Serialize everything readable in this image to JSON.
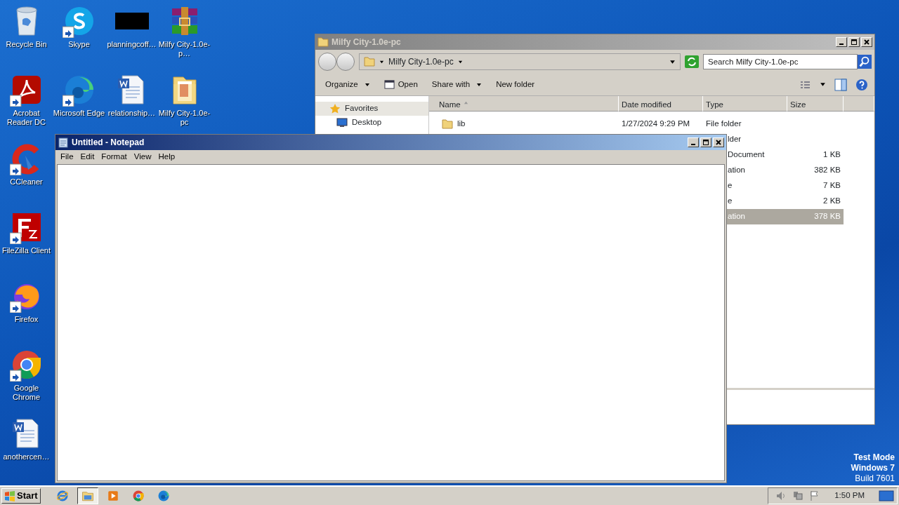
{
  "desktop": {
    "columns": [
      [
        {
          "label": "Recycle Bin",
          "kind": "recycle",
          "shortcut": false
        },
        {
          "label": "Acrobat Reader DC",
          "kind": "acrobat",
          "shortcut": true
        },
        {
          "label": "CCleaner",
          "kind": "ccleaner",
          "shortcut": true
        },
        {
          "label": "FileZilla Client",
          "kind": "filezilla",
          "shortcut": true
        },
        {
          "label": "Firefox",
          "kind": "firefox",
          "shortcut": true
        },
        {
          "label": "Google Chrome",
          "kind": "chrome",
          "shortcut": true
        },
        {
          "label": "anothercen…",
          "kind": "word",
          "shortcut": false
        }
      ],
      [
        {
          "label": "Skype",
          "kind": "skype",
          "shortcut": true
        },
        {
          "label": "Microsoft Edge",
          "kind": "edge",
          "shortcut": true
        }
      ],
      [
        {
          "label": "planningcoff…",
          "kind": "thumb",
          "shortcut": false
        },
        {
          "label": "relationship…",
          "kind": "word",
          "shortcut": false
        }
      ],
      [
        {
          "label": "Milfy City-1.0e-p…",
          "kind": "winrar",
          "shortcut": false
        },
        {
          "label": "Milfy City-1.0e-pc",
          "kind": "folder",
          "shortcut": false
        }
      ]
    ]
  },
  "explorer": {
    "title": "Milfy City-1.0e-pc",
    "active": false,
    "breadcrumb": "Milfy City-1.0e-pc",
    "search": {
      "placeholder": "Search Milfy City-1.0e-pc"
    },
    "toolbar": [
      {
        "label": "Organize",
        "kind": "menu"
      },
      {
        "label": "Open",
        "kind": "open"
      },
      {
        "label": "Share with",
        "kind": "menu"
      },
      {
        "label": "New folder",
        "kind": "plain"
      }
    ],
    "sidebar": [
      {
        "label": "Favorites",
        "kind": "star"
      },
      {
        "label": "Desktop",
        "kind": "desktop"
      }
    ],
    "columns": [
      {
        "label": "Name",
        "sorted": true
      },
      {
        "label": "Date modified",
        "sorted": false
      },
      {
        "label": "Type",
        "sorted": false
      },
      {
        "label": "Size",
        "sorted": false
      }
    ],
    "rows": [
      {
        "name": "lib",
        "date": "1/27/2024 9:29 PM",
        "type": "File folder",
        "size": "",
        "selected": false
      },
      {
        "type": "lder",
        "size": "",
        "selected": false
      },
      {
        "type": "Document",
        "size": "1 KB",
        "selected": false
      },
      {
        "type": "ation",
        "size": "382 KB",
        "selected": false
      },
      {
        "type": "e",
        "size": "7 KB",
        "selected": false
      },
      {
        "type": "e",
        "size": "2 KB",
        "selected": false
      },
      {
        "type": "ation",
        "size": "378 KB",
        "selected": true
      }
    ]
  },
  "notepad": {
    "title": "Untitled - Notepad",
    "active": true,
    "menu": [
      "File",
      "Edit",
      "Format",
      "View",
      "Help"
    ]
  },
  "watermark": [
    "Test Mode",
    "Windows 7",
    "Build 7601"
  ],
  "taskbar": {
    "start": "Start",
    "apps": [
      {
        "kind": "ie",
        "selected": false
      },
      {
        "kind": "explorer",
        "selected": true
      },
      {
        "kind": "media",
        "selected": false
      },
      {
        "kind": "chrome",
        "selected": false
      },
      {
        "kind": "edge",
        "selected": false
      }
    ],
    "clock": "1:50 PM"
  }
}
